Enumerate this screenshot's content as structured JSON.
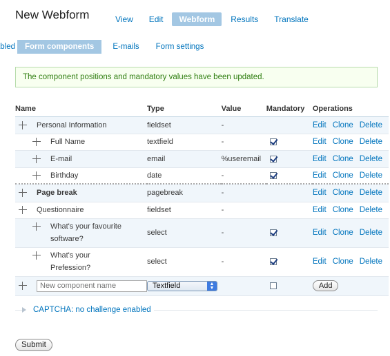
{
  "page": {
    "title": "New Webform"
  },
  "primary_tabs": [
    {
      "label": "View",
      "active": false
    },
    {
      "label": "Edit",
      "active": false
    },
    {
      "label": "Webform",
      "active": true
    },
    {
      "label": "Results",
      "active": false
    },
    {
      "label": "Translate",
      "active": false
    }
  ],
  "secondary_tabs": {
    "cut_label": "Enabled",
    "items": [
      {
        "label": "Form components",
        "active": true
      },
      {
        "label": "E-mails",
        "active": false
      },
      {
        "label": "Form settings",
        "active": false
      }
    ]
  },
  "message": "The component positions and mandatory values have been updated.",
  "table": {
    "headers": {
      "name": "Name",
      "type": "Type",
      "value": "Value",
      "mandatory": "Mandatory",
      "operations": "Operations"
    },
    "rows": [
      {
        "name": "Personal Information",
        "type": "fieldset",
        "value": "-",
        "mandatory": null,
        "indent": 0
      },
      {
        "name": "Full Name",
        "type": "textfield",
        "value": "-",
        "mandatory": true,
        "indent": 1
      },
      {
        "name": "E-mail",
        "type": "email",
        "value": "%useremail",
        "mandatory": true,
        "indent": 1
      },
      {
        "name": "Birthday",
        "type": "date",
        "value": "-",
        "mandatory": true,
        "indent": 1
      },
      {
        "name": "Page break",
        "type": "pagebreak",
        "value": "-",
        "mandatory": null,
        "indent": 0
      },
      {
        "name": "Questionnaire",
        "type": "fieldset",
        "value": "-",
        "mandatory": null,
        "indent": 0
      },
      {
        "name_line1": "What's your favourite",
        "name_line2": "software?",
        "type": "select",
        "value": "-",
        "mandatory": true,
        "indent": 1
      },
      {
        "name_line1": "What's your",
        "name_line2": "Prefession?",
        "type": "select",
        "value": "-",
        "mandatory": true,
        "indent": 1
      }
    ],
    "operations": {
      "edit": "Edit",
      "clone": "Clone",
      "delete": "Delete"
    },
    "add_row": {
      "name_placeholder": "New component name",
      "type_selected": "Textfield",
      "mandatory": false,
      "add_label": "Add"
    }
  },
  "captcha": {
    "label": "CAPTCHA: no challenge enabled",
    "icon": "triangle-right-icon"
  },
  "submit_label": "Submit",
  "colors": {
    "link": "#0074bd",
    "tab_active": "#a3c7e3",
    "message_text": "#2f7e10",
    "message_border": "#b6dbaa"
  }
}
